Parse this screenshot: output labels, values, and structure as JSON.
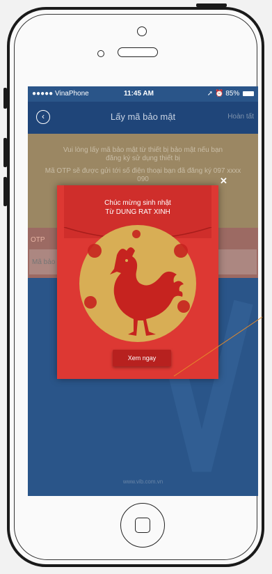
{
  "status_bar": {
    "carrier": "●●●●● VinaPhone",
    "time": "11:45 AM",
    "battery": "85%"
  },
  "nav": {
    "back_icon": "back-arrow-icon",
    "title": "Lấy mã bảo mật",
    "done": "Hoàn tất"
  },
  "info": {
    "line1": "Vui lòng lấy mã bảo mật từ thiết bị bảo mật nếu bạn đăng ký sử dụng thiết bị",
    "line2": "Mã OTP sẽ được gửi tới số điện thoại bạn đã đăng ký 097 xxxx 090"
  },
  "form": {
    "otp_label": "OTP",
    "otp_placeholder": "Mã bảo mật"
  },
  "footer": {
    "url": "www.vib.com.vn"
  },
  "popup": {
    "close_icon": "close-x-icon",
    "greeting": "Chúc mừng sinh nhật",
    "from": "Từ DUNG RAT XINH",
    "button": "Xem ngay",
    "colors": {
      "background": "#dd3833",
      "medallion": "#d8ae55",
      "rooster": "#c6231f"
    }
  }
}
